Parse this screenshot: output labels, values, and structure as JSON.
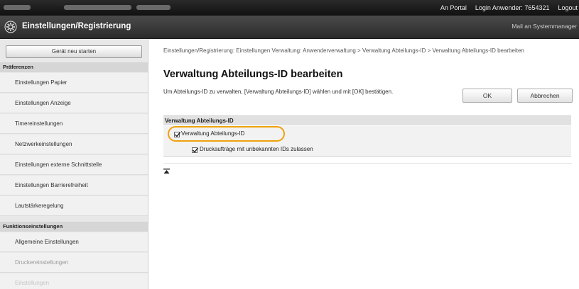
{
  "topbar": {
    "portal_link": "An Portal",
    "login_user": "Login Anwender:  7654321",
    "logout": "Logout"
  },
  "header": {
    "title": "Einstellungen/Registrierung",
    "mail_link": "Mail an Systemmanager"
  },
  "sidebar": {
    "restart_button": "Gerät neu starten",
    "section_preferences": "Präferenzen",
    "items_preferences": [
      "Einstellungen Papier",
      "Einstellungen Anzeige",
      "Timereinstellungen",
      "Netzwerkeinstellungen",
      "Einstellungen externe Schnittstelle",
      "Einstellungen Barrierefreiheit",
      "Lautstärkeregelung"
    ],
    "section_functions": "Funktionseinstellungen",
    "items_functions": [
      "Allgemeine Einstellungen",
      "Druckereinstellungen",
      "Einstellungen"
    ]
  },
  "main": {
    "breadcrumb": "Einstellungen/Registrierung: Einstellungen Verwaltung: Anwenderverwaltung > Verwaltung Abteilungs-ID > Verwaltung Abteilungs-ID bearbeiten",
    "page_title": "Verwaltung Abteilungs-ID bearbeiten",
    "instruction": "Um Abteilungs-ID zu verwalten, [Verwaltung Abteilungs-ID] wählen und mit [OK] bestätigen.",
    "ok_button": "OK",
    "cancel_button": "Abbrechen",
    "panel_title": "Verwaltung Abteilungs-ID",
    "option1_label": "Verwaltung Abteilungs-ID",
    "option1_checked": true,
    "option2_label": "Druckaufträge mit unbekannten IDs zulassen",
    "option2_checked": true
  },
  "colors": {
    "highlight": "#f0a10a",
    "header_dark": "#2b2b2b"
  }
}
